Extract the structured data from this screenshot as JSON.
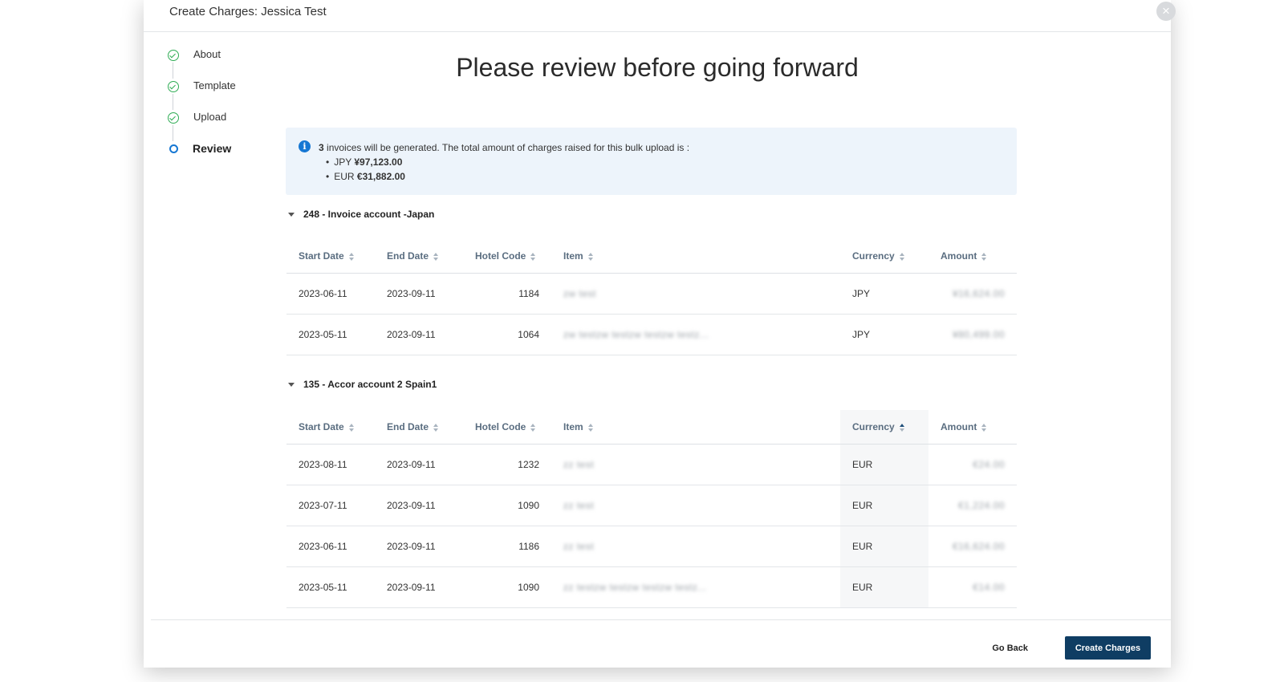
{
  "modal": {
    "title": "Create Charges: Jessica Test",
    "close_glyph": "×"
  },
  "stepper": {
    "steps": [
      {
        "label": "About",
        "state": "done"
      },
      {
        "label": "Template",
        "state": "done"
      },
      {
        "label": "Upload",
        "state": "done"
      },
      {
        "label": "Review",
        "state": "current"
      }
    ]
  },
  "page_title": "Please review before going forward",
  "info": {
    "icon": "info-icon",
    "count": "3",
    "message": " invoices will be generated. The total amount of charges raised for this bulk upload is :",
    "totals": [
      {
        "currency": "JPY",
        "amount": "¥97,123.00"
      },
      {
        "currency": "EUR",
        "amount": "€31,882.00"
      }
    ]
  },
  "columns": [
    "Start Date",
    "End Date",
    "Hotel Code",
    "Item",
    "Currency",
    "Amount"
  ],
  "groups": [
    {
      "title": "248 - Invoice account -Japan",
      "sorted_column": null,
      "rows": [
        {
          "start": "2023-06-11",
          "end": "2023-09-11",
          "hotel": "1184",
          "item": "zw test",
          "currency": "JPY",
          "amount": "¥16,624.00"
        },
        {
          "start": "2023-05-11",
          "end": "2023-09-11",
          "hotel": "1064",
          "item": "zw testzw testzw testzw testz...",
          "currency": "JPY",
          "amount": "¥80,499.00"
        }
      ]
    },
    {
      "title": "135 - Accor account 2 Spain1",
      "sorted_column": "Currency",
      "rows": [
        {
          "start": "2023-08-11",
          "end": "2023-09-11",
          "hotel": "1232",
          "item": "zz test",
          "currency": "EUR",
          "amount": "€24.00"
        },
        {
          "start": "2023-07-11",
          "end": "2023-09-11",
          "hotel": "1090",
          "item": "zz test",
          "currency": "EUR",
          "amount": "€1,224.00"
        },
        {
          "start": "2023-06-11",
          "end": "2023-09-11",
          "hotel": "1186",
          "item": "zz test",
          "currency": "EUR",
          "amount": "€16,624.00"
        },
        {
          "start": "2023-05-11",
          "end": "2023-09-11",
          "hotel": "1090",
          "item": "zz testzw testzw testzw testz...",
          "currency": "EUR",
          "amount": "€14.00"
        }
      ]
    }
  ],
  "footer": {
    "back_label": "Go Back",
    "create_label": "Create Charges"
  },
  "colors": {
    "primary": "#0f3d63",
    "done": "#2eac54",
    "current": "#1677d3",
    "info_bg": "#edf4fb"
  }
}
